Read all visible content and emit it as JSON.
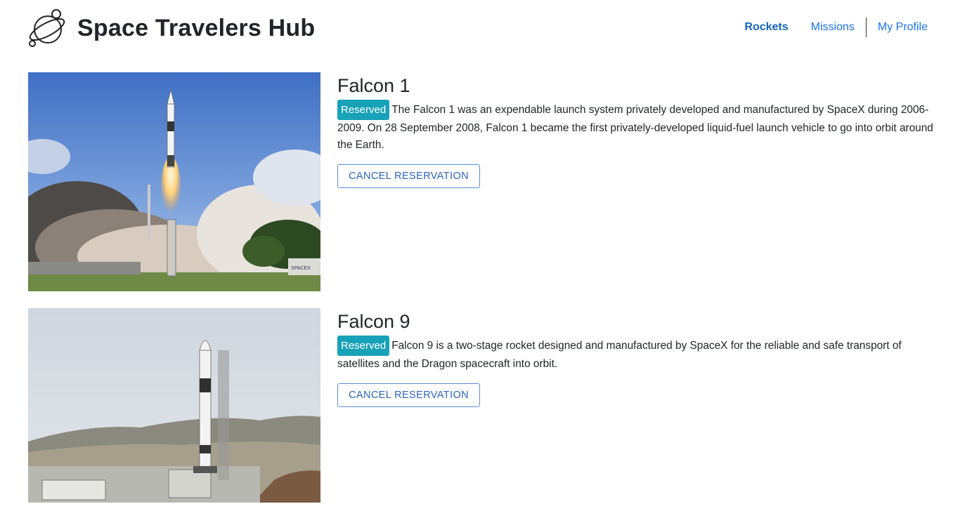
{
  "header": {
    "brand": "Space Travelers Hub",
    "nav": {
      "rockets": "Rockets",
      "missions": "Missions",
      "profile": "My Profile"
    }
  },
  "rockets": [
    {
      "name": "Falcon 1",
      "badge": "Reserved",
      "description": "The Falcon 1 was an expendable launch system privately developed and manufactured by SpaceX during 2006-2009. On 28 September 2008, Falcon 1 became the first privately-developed liquid-fuel launch vehicle to go into orbit around the Earth.",
      "button": "CANCEL RESERVATION",
      "image_caption": "SPACEX"
    },
    {
      "name": "Falcon 9",
      "badge": "Reserved",
      "description": "Falcon 9 is a two-stage rocket designed and manufactured by SpaceX for the reliable and safe transport of satellites and the Dragon spacecraft into orbit.",
      "button": "CANCEL RESERVATION"
    }
  ],
  "colors": {
    "accent": "#1a73e8",
    "badge": "#17a2b8",
    "button_border": "#5b8fd6"
  }
}
